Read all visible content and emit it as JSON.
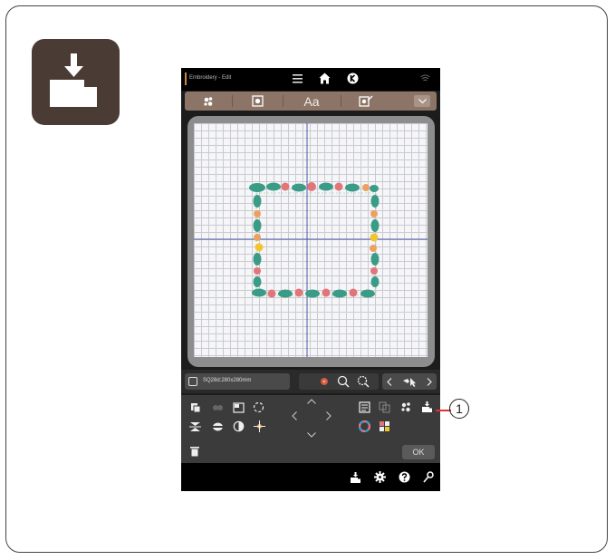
{
  "screen": {
    "title": "Embroidery - Edit",
    "tabs": [
      {
        "icon": "flower-pattern-icon"
      },
      {
        "icon": "pattern-select-icon"
      },
      {
        "label": "Aa"
      },
      {
        "icon": "edit-pattern-icon"
      },
      {
        "icon": "collapse-chevron-icon"
      }
    ],
    "hoop_size": "SQ28d:280x280mm",
    "ok_label": "OK"
  },
  "callout": {
    "number": "1"
  },
  "colors": {
    "tile": "#4a3b35",
    "tab_bar": "#8c7466",
    "leaf_green": "#3a9b86",
    "flower_pink": "#e2757a",
    "flower_orange": "#eea15f",
    "flower_yellow": "#f1c432",
    "axis_line": "#4a59a8",
    "callout_line": "#dd3333"
  }
}
